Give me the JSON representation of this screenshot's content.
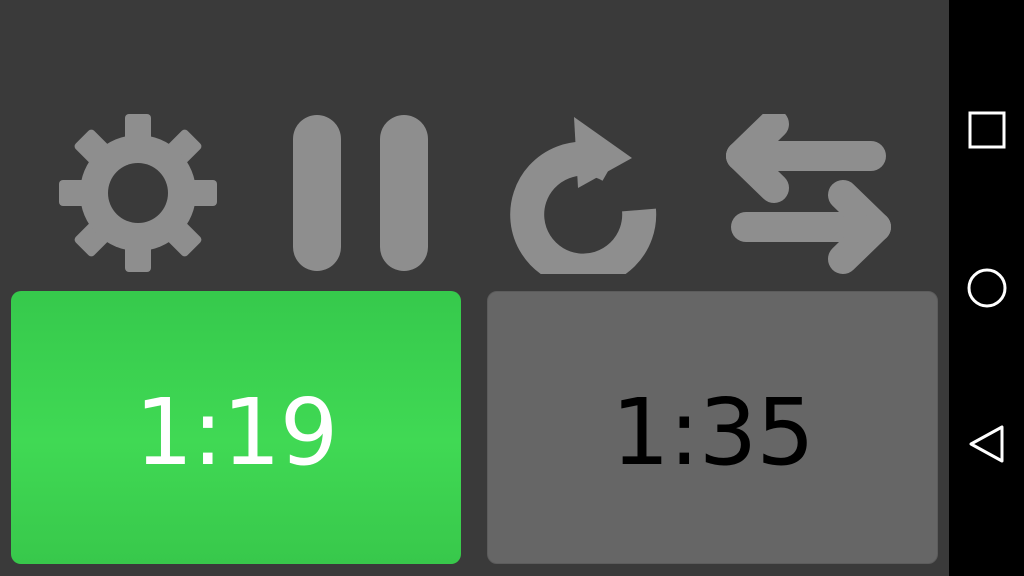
{
  "toolbar": {
    "buttons": [
      {
        "name": "settings",
        "icon": "gear-icon"
      },
      {
        "name": "pause",
        "icon": "pause-icon"
      },
      {
        "name": "reset",
        "icon": "refresh-icon"
      },
      {
        "name": "swap",
        "icon": "swap-arrows-icon"
      }
    ],
    "icon_color": "#8e8e8e"
  },
  "clocks": {
    "left": {
      "time": "1:19",
      "active": true,
      "color": "#3fd654",
      "text_color": "#ffffff"
    },
    "right": {
      "time": "1:35",
      "active": false,
      "color": "#666666",
      "text_color": "#000000"
    }
  },
  "colors": {
    "background": "#3a3a3a",
    "navbar": "#000000"
  },
  "navbar": {
    "buttons": [
      {
        "name": "recents",
        "icon": "square-icon"
      },
      {
        "name": "home",
        "icon": "circle-icon"
      },
      {
        "name": "back",
        "icon": "triangle-back-icon"
      }
    ]
  }
}
